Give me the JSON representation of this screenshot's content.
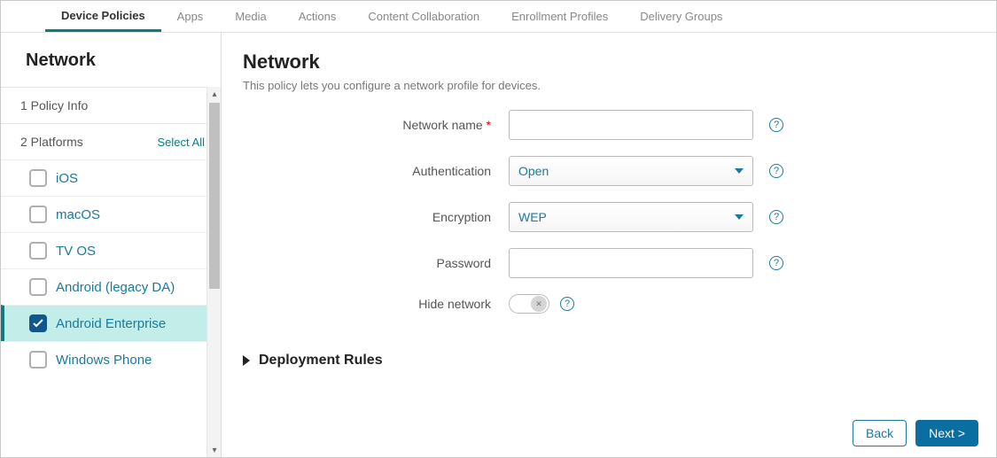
{
  "tabs": {
    "items": [
      {
        "label": "Device Policies",
        "active": true
      },
      {
        "label": "Apps"
      },
      {
        "label": "Media"
      },
      {
        "label": "Actions"
      },
      {
        "label": "Content Collaboration"
      },
      {
        "label": "Enrollment Profiles"
      },
      {
        "label": "Delivery Groups"
      }
    ]
  },
  "sidebar": {
    "title": "Network",
    "step1": "1  Policy Info",
    "step2": "2  Platforms",
    "select_all": "Select All",
    "platforms": [
      {
        "label": "iOS",
        "checked": false
      },
      {
        "label": "macOS",
        "checked": false
      },
      {
        "label": "TV OS",
        "checked": false
      },
      {
        "label": "Android (legacy DA)",
        "checked": false
      },
      {
        "label": "Android Enterprise",
        "checked": true
      },
      {
        "label": "Windows Phone",
        "checked": false
      }
    ]
  },
  "main": {
    "heading": "Network",
    "subtitle": "This policy lets you configure a network profile for devices.",
    "labels": {
      "network_name": "Network name",
      "authentication": "Authentication",
      "encryption": "Encryption",
      "password": "Password",
      "hide_network": "Hide network"
    },
    "values": {
      "network_name": "",
      "authentication": "Open",
      "encryption": "WEP",
      "password": "",
      "hide_network": false
    },
    "deployment_rules": "Deployment Rules",
    "help_glyph": "?"
  },
  "footer": {
    "back": "Back",
    "next": "Next >"
  }
}
